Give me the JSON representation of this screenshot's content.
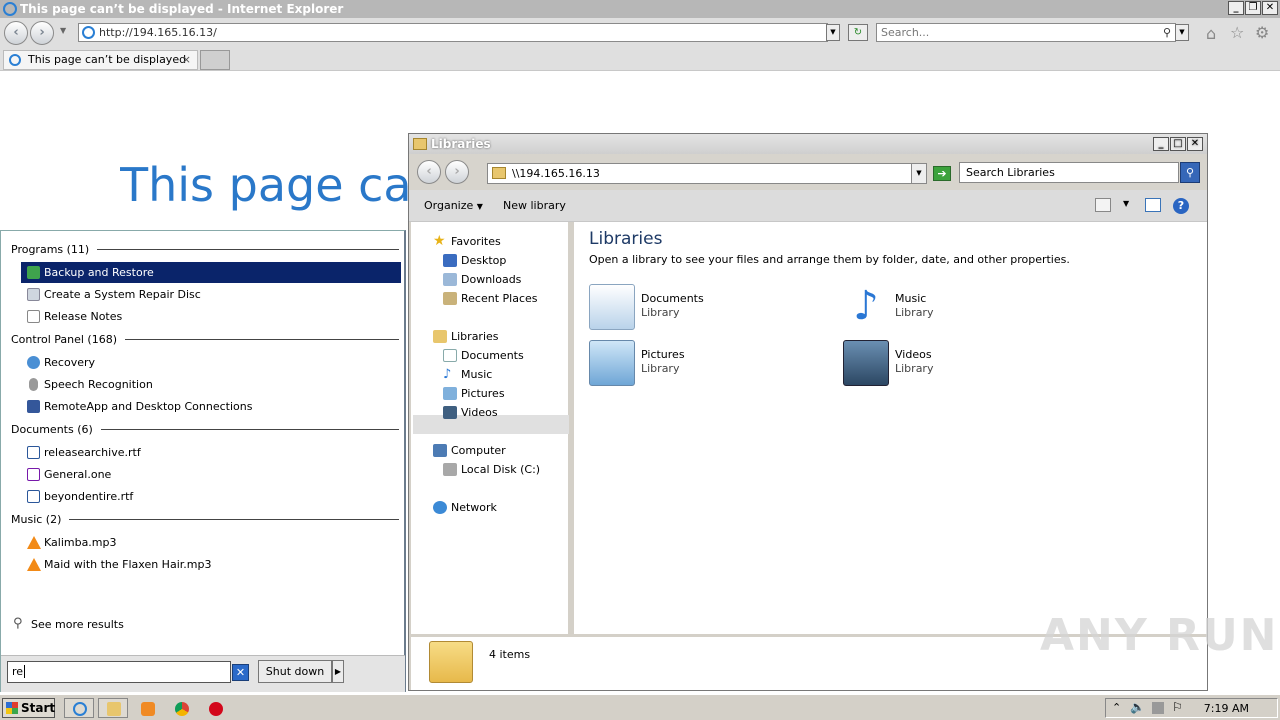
{
  "ie": {
    "title": "This page can’t be displayed - Internet Explorer",
    "address": "http://194.165.16.13/",
    "search_placeholder": "Search...",
    "tab_label": "This page can’t be displayed",
    "heading": "This page can’t be displayed"
  },
  "start_menu": {
    "groups": [
      {
        "label": "Programs (11)"
      },
      {
        "label": "Control Panel (168)"
      },
      {
        "label": "Documents (6)"
      },
      {
        "label": "Music (2)"
      }
    ],
    "programs": [
      "Backup and Restore",
      "Create a System Repair Disc",
      "Release Notes"
    ],
    "control_panel": [
      "Recovery",
      "Speech Recognition",
      "RemoteApp and Desktop Connections"
    ],
    "documents": [
      "releasearchive.rtf",
      "General.one",
      "beyondentire.rtf"
    ],
    "music": [
      "Kalimba.mp3",
      "Maid with the Flaxen Hair.mp3"
    ],
    "see_more": "See more results",
    "search_value": "re",
    "shutdown_label": "Shut down"
  },
  "explorer": {
    "title": "Libraries",
    "address": "\\\\194.165.16.13",
    "search_placeholder": "Search Libraries",
    "toolbar": {
      "organize": "Organize",
      "new_library": "New library"
    },
    "nav": {
      "favorites": "Favorites",
      "desktop": "Desktop",
      "downloads": "Downloads",
      "recent": "Recent Places",
      "libraries": "Libraries",
      "documents": "Documents",
      "music": "Music",
      "pictures": "Pictures",
      "videos": "Videos",
      "computer": "Computer",
      "local_disk": "Local Disk (C:)",
      "network": "Network"
    },
    "content_title": "Libraries",
    "content_desc": "Open a library to see your files and arrange them by folder, date, and other properties.",
    "libraries": [
      {
        "name": "Documents",
        "kind": "Library"
      },
      {
        "name": "Music",
        "kind": "Library"
      },
      {
        "name": "Pictures",
        "kind": "Library"
      },
      {
        "name": "Videos",
        "kind": "Library"
      }
    ],
    "item_count": "4 items"
  },
  "watermark": "ANY RUN",
  "taskbar": {
    "start_label": "Start",
    "clock": "7:19 AM"
  },
  "colors": {
    "ie_heading": "#2a78c9",
    "selection": "#0a246a",
    "accent": "#3667b8"
  }
}
